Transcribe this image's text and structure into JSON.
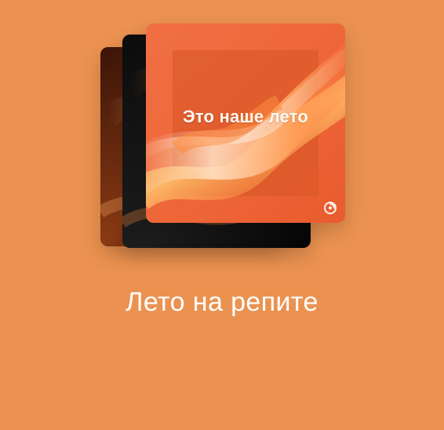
{
  "card": {
    "title": "Лето на репите"
  },
  "playlist": {
    "front_cover_title": "Это наше лето",
    "covers": [
      "front-cover",
      "back-cover-2",
      "back-cover-1"
    ],
    "brand_icon": "spinning-disc-icon"
  },
  "colors": {
    "background": "#EB9250",
    "front_cover": "#EC6B3D",
    "front_cover_inner": "#D85727",
    "text": "#FFFFFF"
  }
}
